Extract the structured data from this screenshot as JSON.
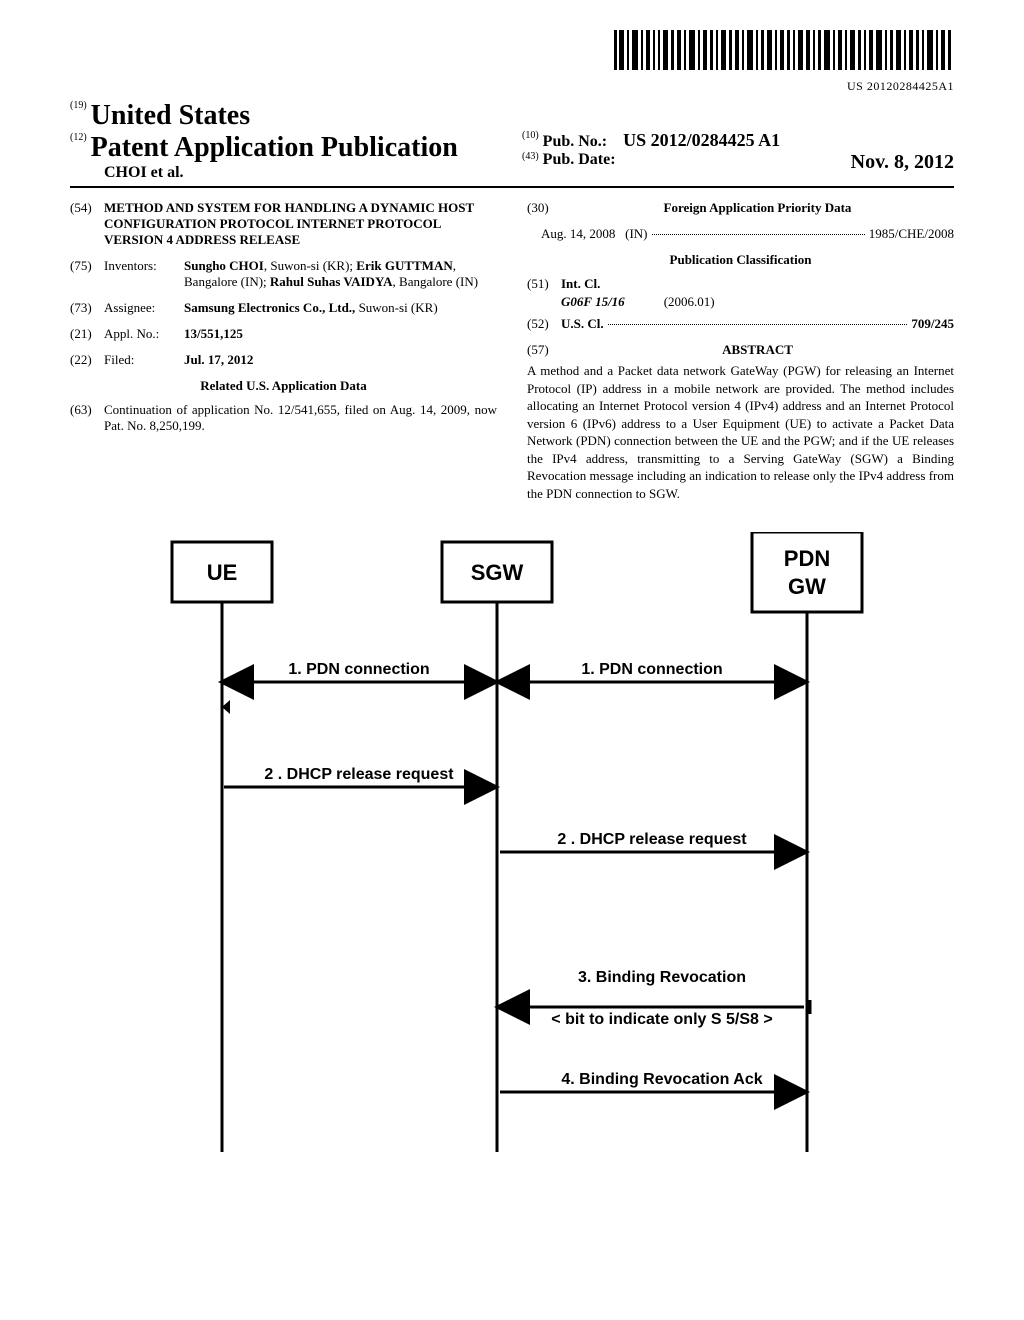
{
  "barcode_number": "US 20120284425A1",
  "header": {
    "country_code": "(19)",
    "country": "United States",
    "pub_type_code": "(12)",
    "pub_type": "Patent Application Publication",
    "authors_line": "CHOI et al.",
    "pubno_code": "(10)",
    "pubno_label": "Pub. No.:",
    "pubno_value": "US 2012/0284425 A1",
    "pubdate_code": "(43)",
    "pubdate_label": "Pub. Date:",
    "pubdate_value": "Nov. 8, 2012"
  },
  "left": {
    "title_code": "(54)",
    "title": "METHOD AND SYSTEM FOR HANDLING A DYNAMIC HOST CONFIGURATION PROTOCOL INTERNET PROTOCOL VERSION 4 ADDRESS RELEASE",
    "inventors_code": "(75)",
    "inventors_label": "Inventors:",
    "inventors": "Sungho CHOI, Suwon-si (KR); Erik GUTTMAN, Bangalore (IN); Rahul Suhas VAIDYA, Bangalore (IN)",
    "inventors_html_parts": [
      {
        "bold": "Sungho CHOI",
        "rest": ", Suwon-si (KR); "
      },
      {
        "bold": "Erik GUTTMAN",
        "rest": ", Bangalore (IN); "
      },
      {
        "bold": "Rahul Suhas VAIDYA",
        "rest": ", Bangalore (IN)"
      }
    ],
    "assignee_code": "(73)",
    "assignee_label": "Assignee:",
    "assignee_bold": "Samsung Electronics Co., Ltd.,",
    "assignee_rest": " Suwon-si (KR)",
    "applno_code": "(21)",
    "applno_label": "Appl. No.:",
    "applno_value": "13/551,125",
    "filed_code": "(22)",
    "filed_label": "Filed:",
    "filed_value": "Jul. 17, 2012",
    "related_heading": "Related U.S. Application Data",
    "continuation_code": "(63)",
    "continuation_text": "Continuation of application No. 12/541,655, filed on Aug. 14, 2009, now Pat. No. 8,250,199."
  },
  "right": {
    "foreign_code": "(30)",
    "foreign_heading": "Foreign Application Priority Data",
    "foreign_date": "Aug. 14, 2008",
    "foreign_country": "(IN)",
    "foreign_num": "1985/CHE/2008",
    "pubclass_heading": "Publication Classification",
    "intcl_code": "(51)",
    "intcl_label": "Int. Cl.",
    "intcl_class": "G06F 15/16",
    "intcl_date": "(2006.01)",
    "uscl_code": "(52)",
    "uscl_label": "U.S. Cl.",
    "uscl_value": "709/245",
    "abstract_code": "(57)",
    "abstract_label": "ABSTRACT",
    "abstract": "A method and a Packet data network GateWay (PGW) for releasing an Internet Protocol (IP) address in a mobile network are provided. The method includes allocating an Internet Protocol version 4 (IPv4) address and an Internet Protocol version 6 (IPv6) address to a User Equipment (UE) to activate a Packet Data Network (PDN) connection between the UE and the PGW; and if the UE releases the IPv4 address, transmitting to a Serving GateWay (SGW) a Binding Revocation message including an indication to release only the IPv4 address from the PDN connection to SGW."
  },
  "diagram": {
    "nodes": {
      "ue": "UE",
      "sgw": "SGW",
      "pdngw1": "PDN",
      "pdngw2": "GW"
    },
    "msgs": {
      "pdn1": "1. PDN connection",
      "pdn2": "1. PDN connection",
      "dhcp1": "2 . DHCP release request",
      "dhcp2": "2 . DHCP release request",
      "bind1": "3. Binding Revocation",
      "bind1sub": "< bit to indicate only S    5/S8 >",
      "bind2": "4. Binding Revocation Ack"
    }
  }
}
